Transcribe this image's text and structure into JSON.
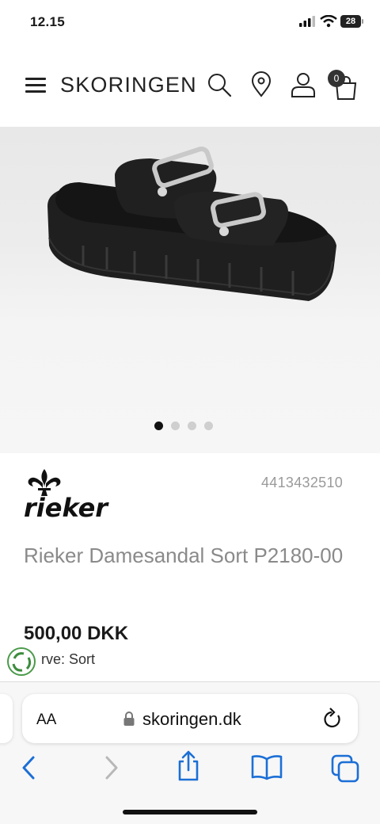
{
  "status_bar": {
    "time": "12.15",
    "battery": "28"
  },
  "header": {
    "logo": "SKORINGEN",
    "cart_count": "0",
    "icons": [
      "menu-icon",
      "search-icon",
      "location-icon",
      "user-icon",
      "cart-icon"
    ]
  },
  "gallery": {
    "images": 4,
    "active_index": 0
  },
  "product": {
    "sku": "4413432510",
    "title": "Rieker Damesandal Sort P2180-00",
    "price": "500,00 DKK",
    "color_label": "rve: Sort"
  },
  "browser": {
    "aa_label": "AA",
    "url": "skoringen.dk",
    "toolbar": [
      "back-icon",
      "forward-icon",
      "share-icon",
      "bookmarks-icon",
      "tabs-icon"
    ]
  },
  "colors": {
    "accent": "#1b6fd6",
    "text": "#1a1a1a",
    "muted": "#8a8a8a"
  }
}
